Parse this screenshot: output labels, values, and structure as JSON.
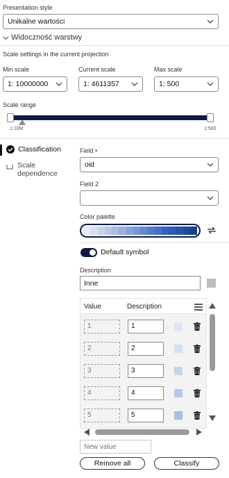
{
  "presentation": {
    "label": "Presentation style",
    "value": "Unikalne wartości"
  },
  "visibility": {
    "label": "Widoczność warstwy"
  },
  "scale": {
    "section_label": "Scale settings in the current projection",
    "min_label": "Min scale",
    "min_value": "1: 10000000",
    "current_label": "Current scale",
    "current_value": "1: 4611357",
    "max_label": "Max scale",
    "max_value": "1: 500",
    "range_label": "Scale range",
    "range_left": "1:10M",
    "range_right": "1:500"
  },
  "sidenav": {
    "classification": "Classification",
    "scale_dependence_1": "Scale",
    "scale_dependence_2": "dependence"
  },
  "field": {
    "label": "Field •",
    "value": "oid"
  },
  "field2": {
    "label": "Field 2",
    "value": ""
  },
  "palette": {
    "label": "Color palette",
    "colors": [
      "#e7ecf7",
      "#d7e0f3",
      "#c8d4ee",
      "#b8c8ea",
      "#a8bce5",
      "#98afe0",
      "#87a2db",
      "#7695d6",
      "#6588d1",
      "#557bcc",
      "#456fc7",
      "#3563c2",
      "#2b5bb8",
      "#2452a8",
      "#1e4a98",
      "#183f86"
    ]
  },
  "default_symbol": {
    "label": "Default symbol",
    "on": true
  },
  "description": {
    "label": "Description",
    "value": "Inne",
    "swatch_color": "#bdbdbd"
  },
  "table": {
    "col_value": "Value",
    "col_description": "Description",
    "rows": [
      {
        "value": "1",
        "description": "1",
        "color": "#dde5f6"
      },
      {
        "value": "2",
        "description": "2",
        "color": "#d3ddf3"
      },
      {
        "value": "3",
        "description": "3",
        "color": "#c6d3ef"
      },
      {
        "value": "4",
        "description": "4",
        "color": "#b6c8eb"
      },
      {
        "value": "5",
        "description": "5",
        "color": "#a9bde6"
      }
    ]
  },
  "new_value": {
    "placeholder": "New value"
  },
  "buttons": {
    "remove_all": "Remove all",
    "classify": "Classify"
  }
}
